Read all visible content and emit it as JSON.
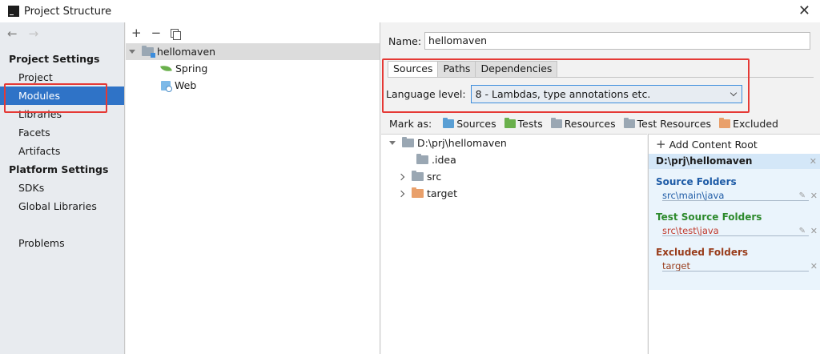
{
  "window": {
    "title": "Project Structure",
    "close_glyph": "✕"
  },
  "nav": {
    "back_glyph": "←",
    "forward_glyph": "→",
    "project_settings_header": "Project Settings",
    "project_settings_items": [
      "Project",
      "Modules",
      "Libraries",
      "Facets",
      "Artifacts"
    ],
    "platform_settings_header": "Platform Settings",
    "platform_settings_items": [
      "SDKs",
      "Global Libraries"
    ],
    "other_items": [
      "Problems"
    ],
    "selected": "Modules"
  },
  "module_tree": {
    "toolbar": {
      "add": "+",
      "remove": "−"
    },
    "root": "hellomaven",
    "children": [
      "Spring",
      "Web"
    ]
  },
  "module_detail": {
    "name_label": "Name:",
    "name_value": "hellomaven",
    "tabs": [
      "Sources",
      "Paths",
      "Dependencies"
    ],
    "active_tab": "Sources",
    "language_level_label": "Language level:",
    "language_level_value": "8 - Lambdas, type annotations etc.",
    "mark_as": {
      "label": "Mark as:",
      "items": [
        {
          "label": "Sources",
          "color": "#5a9fd4"
        },
        {
          "label": "Tests",
          "color": "#6ab04c"
        },
        {
          "label": "Resources",
          "color": "#9aa7b3"
        },
        {
          "label": "Test Resources",
          "color": "#9aa7b3"
        },
        {
          "label": "Excluded",
          "color": "#e9a06b"
        }
      ]
    },
    "content_tree": {
      "root": "D:\\prj\\hellomaven",
      "children": [
        ".idea",
        "src",
        "target"
      ]
    },
    "roots_panel": {
      "add_label": "Add Content Root",
      "root_path": "D:\\prj\\hellomaven",
      "source_folders_title": "Source Folders",
      "source_folder": "src\\main\\java",
      "test_source_folders_title": "Test Source Folders",
      "test_source_folder": "src\\test\\java",
      "excluded_folders_title": "Excluded Folders",
      "excluded_folder": "target"
    }
  }
}
